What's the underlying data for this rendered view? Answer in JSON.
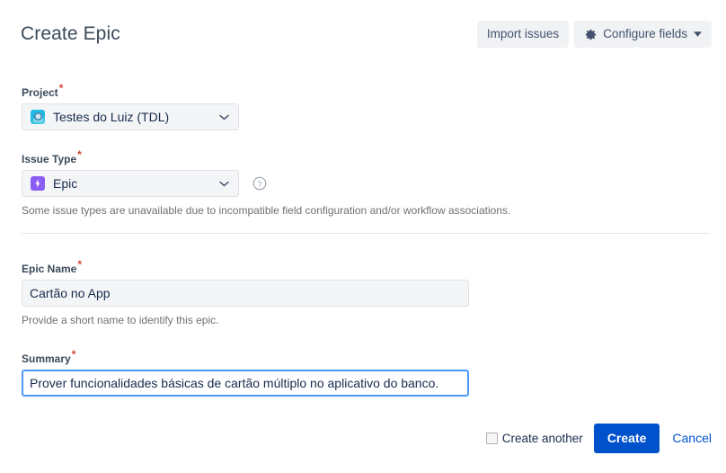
{
  "header": {
    "title": "Create Epic",
    "import_issues_label": "Import issues",
    "configure_fields_label": "Configure fields",
    "gear_icon": "gear-icon",
    "caret_icon": "chevron-down-icon"
  },
  "form": {
    "project": {
      "label": "Project",
      "required_marker": "*",
      "value": "Testes do Luiz (TDL)",
      "icon": "project-avatar-icon"
    },
    "issue_type": {
      "label": "Issue Type",
      "required_marker": "*",
      "value": "Epic",
      "icon": "epic-bolt-icon",
      "help_icon": "question-circle-icon",
      "hint": "Some issue types are unavailable due to incompatible field configuration and/or workflow associations."
    },
    "epic_name": {
      "label": "Epic Name",
      "required_marker": "*",
      "value": "Cartão no App",
      "placeholder": "",
      "hint": "Provide a short name to identify this epic."
    },
    "summary": {
      "label": "Summary",
      "required_marker": "*",
      "value": "Prover funcionalidades básicas de cartão múltiplo no aplicativo do banco.",
      "placeholder": "",
      "focused": true
    }
  },
  "footer": {
    "create_another_label": "Create another",
    "create_another_checked": false,
    "create_label": "Create",
    "cancel_label": "Cancel"
  },
  "colors": {
    "primary": "#0052CC",
    "focus_border": "#4c9aff",
    "required": "#d04437",
    "epic_purple": "#8b5cf6",
    "project_cyan": "#1fb6de",
    "field_bg": "#f4f5f7",
    "text": "#172B4D"
  }
}
